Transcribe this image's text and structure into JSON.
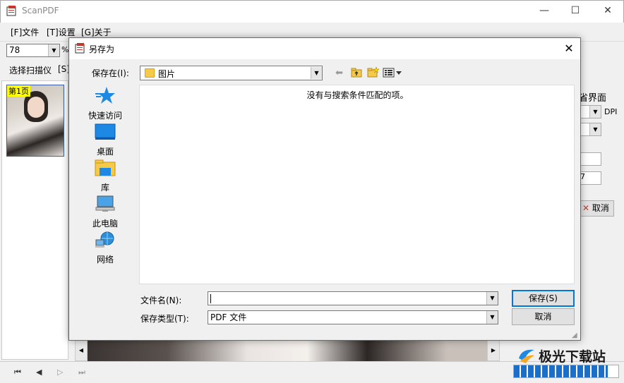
{
  "window": {
    "title": "ScanPDF",
    "minimize_glyph": "—",
    "maximize_glyph": "☐",
    "close_glyph": "✕"
  },
  "menu": [
    "[F]文件",
    "[T]设置",
    "[G]关于"
  ],
  "toolbar": {
    "zoom_value": "78",
    "zoom_unit": "%",
    "select_scanner": "选择扫描仪",
    "s_button": "[S]"
  },
  "thumbnail": {
    "page_label": "第1页"
  },
  "right_panel": {
    "heading": "省界面",
    "dpi_label": "DPI",
    "field_value": "7",
    "cancel_label": "取消"
  },
  "bottom_nav": [
    "⏮",
    "◀",
    "▷",
    "⏭"
  ],
  "progress": {
    "fraction": 0.9
  },
  "dialog": {
    "title": "另存为",
    "save_in_label": "保存在(I):",
    "save_in_value": "图片",
    "places": [
      {
        "label": "快速访问",
        "icon": "star-icon"
      },
      {
        "label": "桌面",
        "icon": "desktop-icon"
      },
      {
        "label": "库",
        "icon": "library-icon"
      },
      {
        "label": "此电脑",
        "icon": "computer-icon"
      },
      {
        "label": "网络",
        "icon": "network-icon"
      }
    ],
    "empty_message": "没有与搜索条件匹配的项。",
    "filename_label": "文件名(N):",
    "filename_value": "",
    "filetype_label": "保存类型(T):",
    "filetype_value": "PDF 文件",
    "save_button": "保存(S)",
    "cancel_button": "取消"
  },
  "watermark": {
    "text": "极光下载站"
  },
  "colors": {
    "accent": "#0078d7",
    "folder": "#f5c94a",
    "highlight": "#ffff00",
    "progress": "#1c6fc9"
  }
}
